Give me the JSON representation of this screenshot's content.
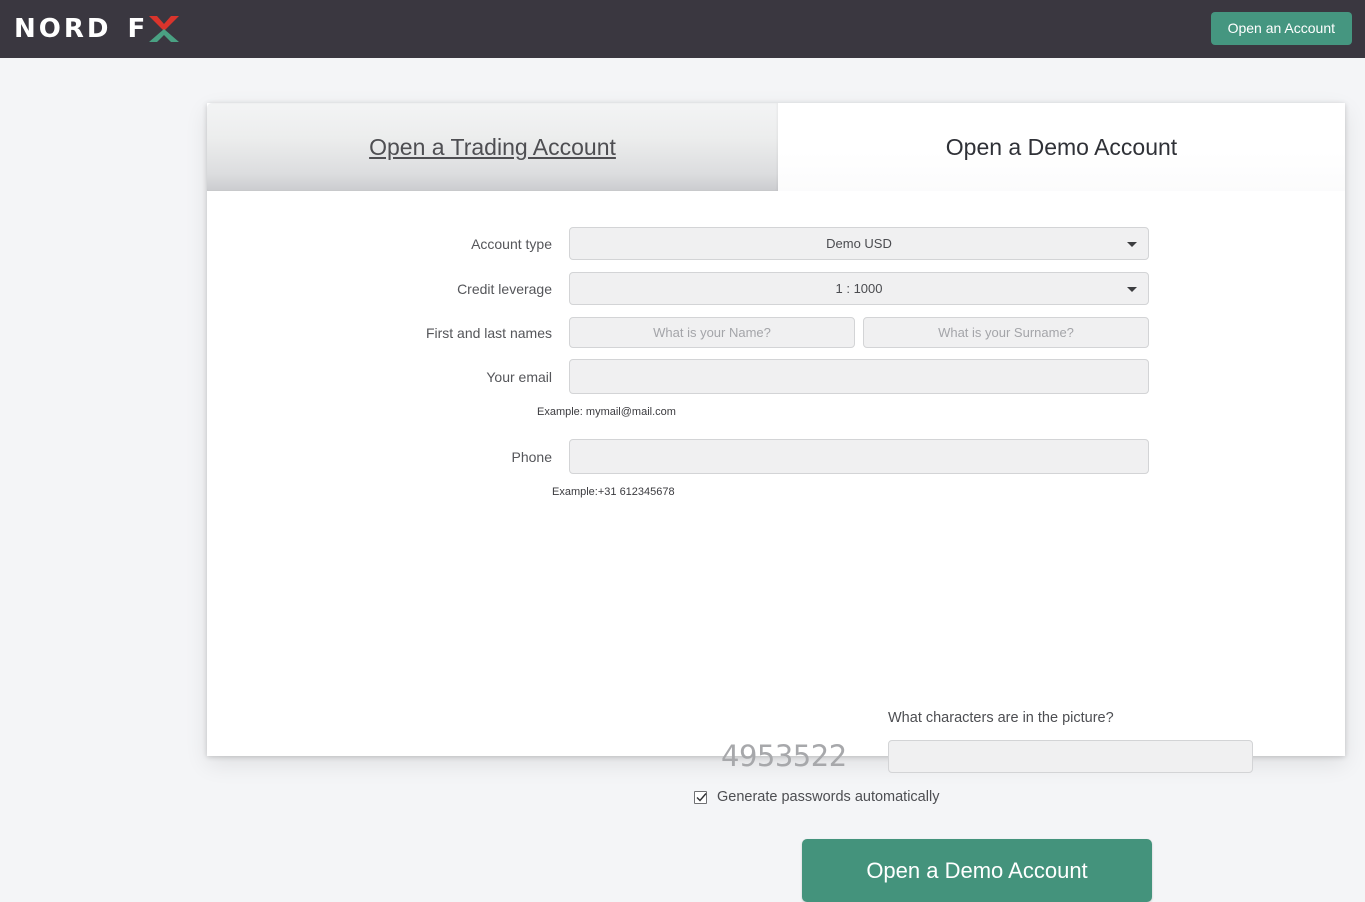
{
  "header": {
    "logo_primary": "NORD",
    "logo_secondary": "F",
    "logo_icon": "x-mark-red-green",
    "cta_label": "Open an Account",
    "bg_color": "#3a3740",
    "cta_color": "#459680"
  },
  "tabs": [
    {
      "label": "Open a Trading Account",
      "active": false
    },
    {
      "label": "Open a Demo Account",
      "active": true
    }
  ],
  "form": {
    "account_type": {
      "label": "Account type",
      "value": "Demo USD"
    },
    "credit_leverage": {
      "label": "Credit leverage",
      "value": "1 : 1000"
    },
    "names": {
      "label": "First and last names",
      "first_placeholder": "What is your Name?",
      "first_value": "",
      "last_placeholder": "What is your Surname?",
      "last_value": ""
    },
    "email": {
      "label": "Your email",
      "value": "",
      "placeholder": "",
      "hint": "Example: mymail@mail.com"
    },
    "phone": {
      "label": "Phone",
      "value": "",
      "placeholder": "",
      "hint": "Example:+31 612345678"
    },
    "captcha": {
      "question": "What characters are in the picture?",
      "image_text": "4953522",
      "input_value": "",
      "input_placeholder": ""
    },
    "generate_passwords": {
      "label": "Generate passwords automatically",
      "checked": true
    },
    "submit_label": "Open a Demo Account",
    "submit_color": "#44937c"
  }
}
